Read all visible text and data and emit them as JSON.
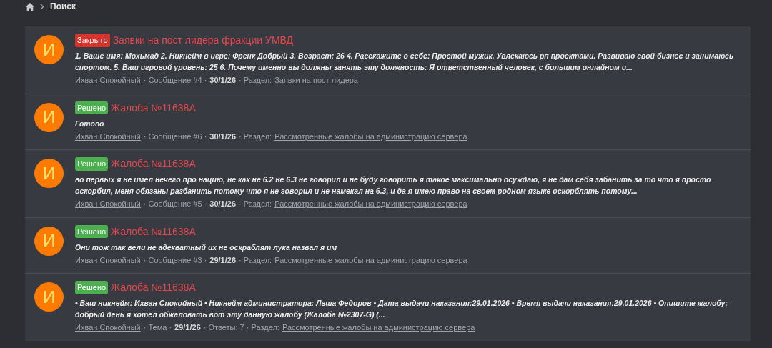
{
  "breadcrumb": {
    "items": [
      {
        "text": "Поиск"
      }
    ]
  },
  "results": [
    {
      "prefix": {
        "text": "Закрыто",
        "color": "#d9342b"
      },
      "title": "Заявки на пост лидера фракции УМВД",
      "snippet": "1. Ваше имя: Мохьмад 2. Никнейм в игре: Френк Добрый 3. Возраст: 26 4. Расскажите о себе: Простой мужик. Увлекаюсь рп проектами. Развиваю свой бизнес и занимаюсь спортом. 5. Ваш игровой уровень: 25 6. Почему именно вы должны занять эту должность: Я ответственный человек, с большим онлайном и...",
      "avatar": "И",
      "meta": [
        {
          "kind": "user",
          "text": "Ихван Спокойный"
        },
        {
          "kind": "text",
          "text": "· Сообщение #4 ·"
        },
        {
          "kind": "date",
          "text": "30/1/26"
        },
        {
          "kind": "text",
          "text": "· Раздел:"
        },
        {
          "kind": "link",
          "text": "Заявки на пост лидера"
        }
      ]
    },
    {
      "prefix": {
        "text": "Решено",
        "color": "#4caf50"
      },
      "title": "Жалоба №11638A",
      "snippet": "Готово",
      "avatar": "И",
      "meta": [
        {
          "kind": "user",
          "text": "Ихван Спокойный"
        },
        {
          "kind": "text",
          "text": "· Сообщение #6 ·"
        },
        {
          "kind": "date",
          "text": "30/1/26"
        },
        {
          "kind": "text",
          "text": "· Раздел:"
        },
        {
          "kind": "link",
          "text": "Рассмотренные жалобы на администрацию сервера"
        }
      ]
    },
    {
      "prefix": {
        "text": "Решено",
        "color": "#4caf50"
      },
      "title": "Жалоба №11638A",
      "snippet": "во первых я не имел нечего про нацию, не как не 6.2 не 6.3 не говорил и не буду говорить я такое максимально осуждаю, я не дам себя забанить за то что я просто оскорбил, меня обязаны разбанить потому что я не говорил и не намекал на 6.3, и да я имею право на своем родном языке оскорблять потому...",
      "avatar": "И",
      "meta": [
        {
          "kind": "user",
          "text": "Ихван Спокойный"
        },
        {
          "kind": "text",
          "text": "· Сообщение #5 ·"
        },
        {
          "kind": "date",
          "text": "30/1/26"
        },
        {
          "kind": "text",
          "text": "· Раздел:"
        },
        {
          "kind": "link",
          "text": "Рассмотренные жалобы на администрацию сервера"
        }
      ]
    },
    {
      "prefix": {
        "text": "Решено",
        "color": "#4caf50"
      },
      "title": "Жалоба №11638A",
      "snippet": "Они тож так вели не адекватный их не оскраблят лука назвал я им",
      "avatar": "И",
      "meta": [
        {
          "kind": "user",
          "text": "Ихван Спокойный"
        },
        {
          "kind": "text",
          "text": "· Сообщение #3 ·"
        },
        {
          "kind": "date",
          "text": "29/1/26"
        },
        {
          "kind": "text",
          "text": "· Раздел:"
        },
        {
          "kind": "link",
          "text": "Рассмотренные жалобы на администрацию сервера"
        }
      ]
    },
    {
      "prefix": {
        "text": "Решено",
        "color": "#4caf50"
      },
      "title": "Жалоба №11638A",
      "snippet": "• Ваш никнейм: Ихван Спокойный • Никнейм администратора: Леша Федоров • Дата выдачи наказания:29.01.2026 • Время выдачи наказания:29.01.2026 • Опишите жалобу: добрый день я хотел обжаловать вот эту данную жалобу (Жалоба №2307-G) (...",
      "avatar": "И",
      "meta": [
        {
          "kind": "user",
          "text": "Ихван Спокойный"
        },
        {
          "kind": "text",
          "text": "· Тема ·"
        },
        {
          "kind": "date",
          "text": "29/1/26"
        },
        {
          "kind": "text",
          "text": "· Ответы: 7 · Раздел:"
        },
        {
          "kind": "link",
          "text": "Рассмотренные жалобы на администрацию сервера"
        }
      ]
    }
  ]
}
